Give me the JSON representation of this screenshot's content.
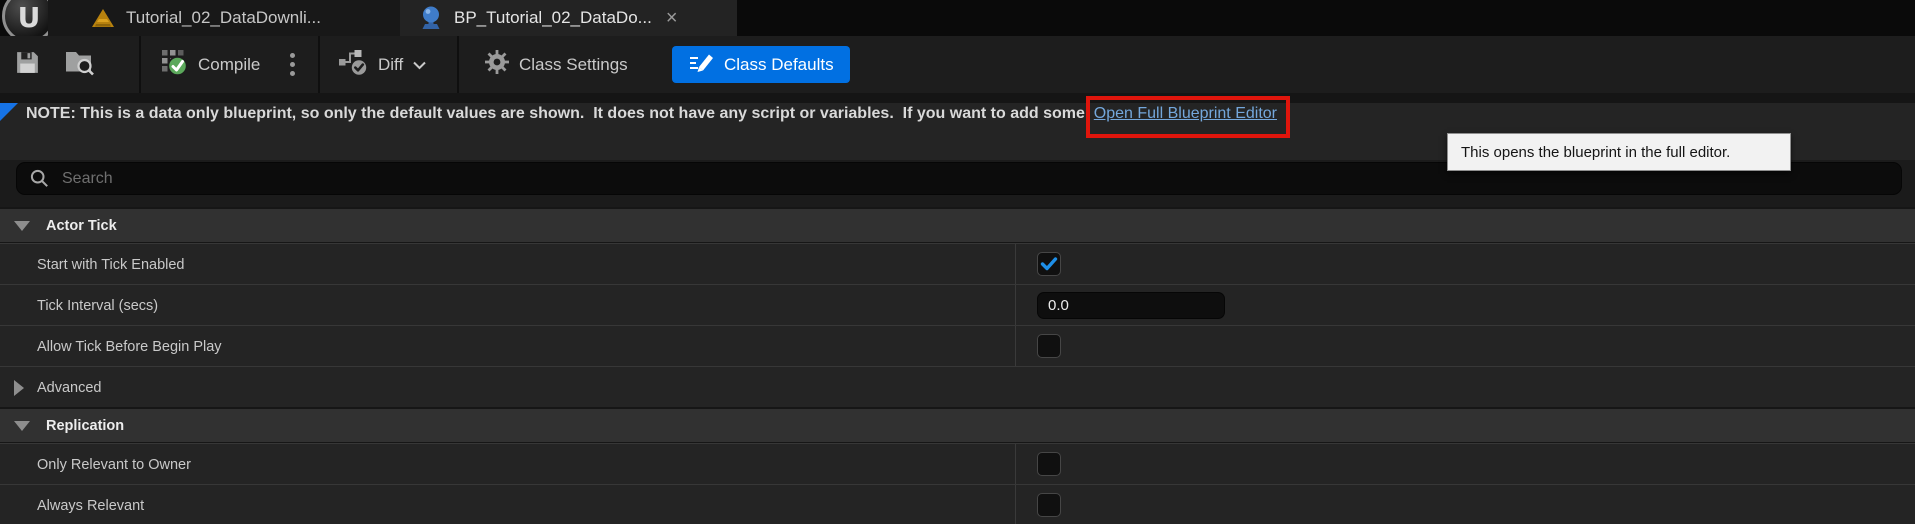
{
  "window": {
    "tabs": [
      {
        "icon": "level-icon",
        "label": "Tutorial_02_DataDownli...",
        "active": false
      },
      {
        "icon": "blueprint-icon",
        "label": "BP_Tutorial_02_DataDo...",
        "active": true,
        "close_glyph": "×"
      }
    ]
  },
  "toolbar": {
    "save_icon": "save-icon",
    "browse_icon": "find-in-content-browser-icon",
    "compile": {
      "label": "Compile",
      "icon": "compile-icon",
      "more_icon": "kebab-menu-icon"
    },
    "diff": {
      "label": "Diff",
      "icon": "diff-icon",
      "chevron_icon": "chevron-down-icon"
    },
    "class_settings": {
      "label": "Class Settings",
      "icon": "gear-icon"
    },
    "class_defaults": {
      "label": "Class Defaults",
      "icon": "pencil-icon"
    }
  },
  "note_bar": {
    "text": "NOTE: This is a data only blueprint, so only the default values are shown.  It does not have any script or variables.  If you want to add some, ",
    "link": "Open Full Blueprint Editor"
  },
  "tooltip": {
    "text": "This opens the blueprint in the full editor."
  },
  "search": {
    "placeholder": "Search",
    "icon": "search-icon"
  },
  "details": {
    "sections": [
      {
        "label": "Actor Tick",
        "expanded": true,
        "rows": [
          {
            "label": "Start with Tick Enabled",
            "control": "checkbox",
            "checked": true
          },
          {
            "label": "Tick Interval (secs)",
            "control": "text-input",
            "value": "0.0"
          },
          {
            "label": "Allow Tick Before Begin Play",
            "control": "checkbox",
            "checked": false
          },
          {
            "label": "Advanced",
            "control": "expander",
            "expanded": false
          }
        ]
      },
      {
        "label": "Replication",
        "expanded": true,
        "rows": [
          {
            "label": "Only Relevant to Owner",
            "control": "checkbox",
            "checked": false
          },
          {
            "label": "Always Relevant",
            "control": "checkbox",
            "checked": false
          }
        ]
      }
    ]
  },
  "colors": {
    "accent_blue": "#0170E2",
    "check_blue": "#1E8FE8",
    "link_blue": "#74A7DB",
    "annotation_red": "#E0150C",
    "focus_corner_blue": "#1673E6"
  }
}
